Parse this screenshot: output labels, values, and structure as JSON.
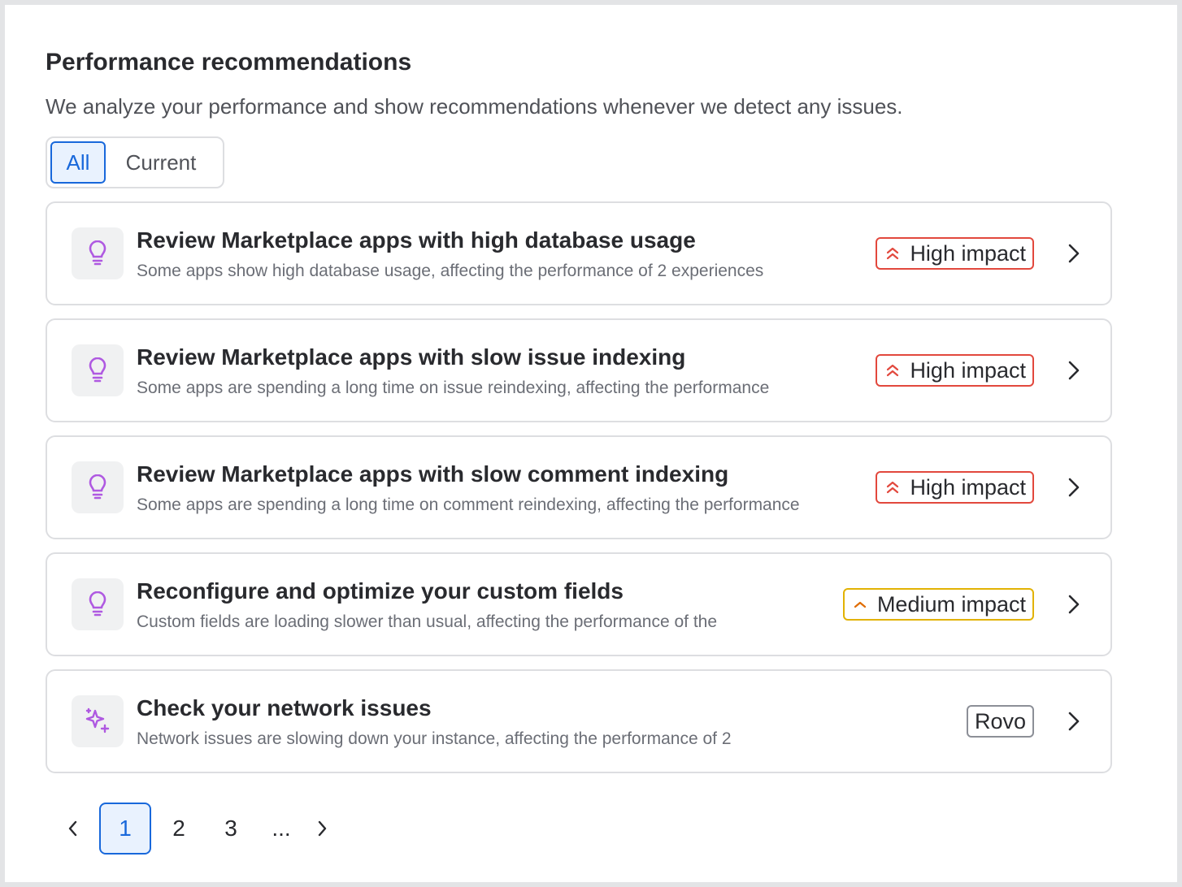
{
  "header": {
    "title": "Performance recommendations",
    "subtitle": "We analyze your performance and show recommendations whenever we detect any issues."
  },
  "filter": {
    "options": [
      "All",
      "Current"
    ],
    "selected": "All"
  },
  "recommendations": [
    {
      "title": "Review Marketplace apps with high database usage",
      "description": "Some apps show high database usage, affecting the performance of 2 experiences",
      "badge": "High impact",
      "badge_type": "high",
      "icon": "lightbulb-icon"
    },
    {
      "title": "Review Marketplace apps with slow issue indexing",
      "description": "Some apps are spending a long time on issue reindexing, affecting the performance",
      "badge": "High impact",
      "badge_type": "high",
      "icon": "lightbulb-icon"
    },
    {
      "title": "Review Marketplace apps with slow comment indexing",
      "description": "Some apps are spending a long time on comment reindexing, affecting the performance",
      "badge": "High impact",
      "badge_type": "high",
      "icon": "lightbulb-icon"
    },
    {
      "title": "Reconfigure and optimize your custom fields",
      "description": "Custom fields are loading slower than usual, affecting the performance of the",
      "badge": "Medium impact",
      "badge_type": "medium",
      "icon": "lightbulb-icon"
    },
    {
      "title": "Check your network issues",
      "description": "Network issues are slowing down your instance, affecting the performance of 2",
      "badge": "Rovo",
      "badge_type": "neutral",
      "icon": "sparkle-icon"
    }
  ],
  "pagination": {
    "pages": [
      "1",
      "2",
      "3"
    ],
    "ellipsis": "...",
    "current": "1"
  },
  "colors": {
    "accent": "#1868db",
    "high": "#e2483d",
    "medium": "#e2b203",
    "icon": "#af59e1"
  }
}
